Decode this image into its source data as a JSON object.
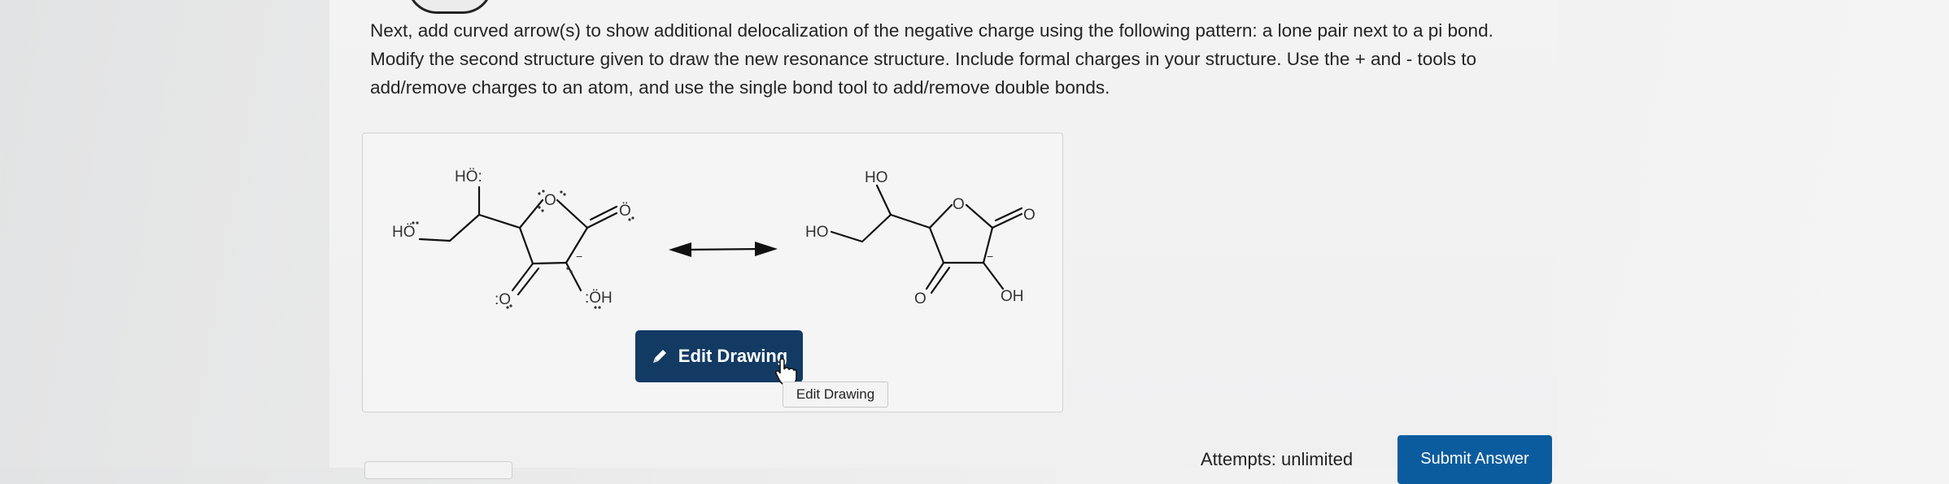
{
  "instructions": "Next, add curved arrow(s) to show additional delocalization of the negative charge using the following pattern: a lone pair next to a pi bond. Modify the second structure given to draw the new resonance structure. Include formal charges in your structure. Use the + and - tools to add/remove charges to an atom, and use the single bond tool to add/remove double bonds.",
  "structure1": {
    "labels": {
      "ho_top": "HÖ:",
      "ho_left": "HÖ",
      "ring_o": "O",
      "carbonyl_o": "Ö",
      "bottom_o": ":O",
      "oh": ":ÖH",
      "minus": "−"
    }
  },
  "structure2": {
    "labels": {
      "ho_top": "HO",
      "ho_left": "HO",
      "ring_o": "O",
      "carbonyl_o": "O",
      "bottom_o": "O",
      "oh": "OH",
      "minus": "−"
    }
  },
  "edit_button": {
    "label": "Edit Drawing",
    "icon": "pencil-icon"
  },
  "tooltip": "Edit Drawing",
  "attempts": "Attempts: unlimited",
  "submit_button": "Submit Answer",
  "colors": {
    "primary_button": "#123a63",
    "submit_button": "#0b5c9e",
    "text": "#242424"
  }
}
